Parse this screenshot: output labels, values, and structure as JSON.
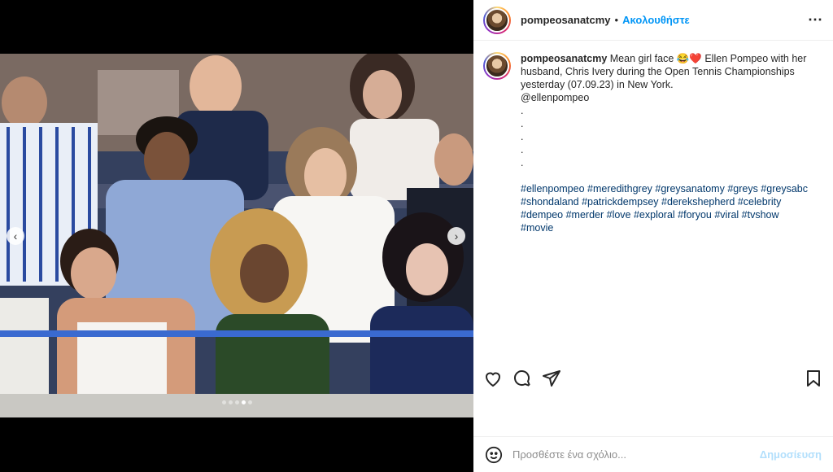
{
  "post": {
    "username": "pompeosanatcmy",
    "separator": "•",
    "follow_label": "Ακολουθήστε",
    "more_icon": "more-horizontal-icon",
    "caption_text": "Mean girl face 😂❤️ Ellen Pompeo with her husband, Chris Ivery during the Open Tennis Championships yesterday (07.09.23) in New York.",
    "mention": "@ellenpompeo",
    "dots": [
      ".",
      ".",
      ".",
      ".",
      "."
    ],
    "hashtags": "#ellenpompeo #meredithgrey #greysanatomy #greys #greysabc #shondaland #patrickdempsey #derekshepherd #celebrity #dempeo #merder #love #exploral #foryou #viral #tvshow #movie"
  },
  "carousel": {
    "prev_icon": "chevron-left-icon",
    "next_icon": "chevron-right-icon",
    "slide_count": 5,
    "active_index": 3
  },
  "actions": {
    "like_icon": "heart-icon",
    "comment_icon": "comment-icon",
    "share_icon": "share-icon",
    "save_icon": "bookmark-icon"
  },
  "comment": {
    "placeholder": "Προσθέστε ένα σχόλιο...",
    "post_label": "Δημοσίευση",
    "emoji_icon": "emoji-icon"
  },
  "colors": {
    "accent": "#0095f6",
    "link": "#00376b",
    "post_disabled": "#b2dffc"
  }
}
